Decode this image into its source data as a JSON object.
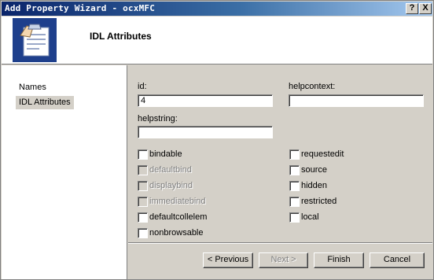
{
  "window": {
    "title": "Add Property Wizard - ocxMFC",
    "help_button": "?",
    "close_button": "X"
  },
  "header": {
    "title": "IDL Attributes",
    "icon": "wizard-clipboard-icon"
  },
  "nav": {
    "items": [
      {
        "label": "Names"
      },
      {
        "label": "IDL Attributes"
      }
    ]
  },
  "form": {
    "id": {
      "label": "id:",
      "value": "4"
    },
    "helpcontext": {
      "label": "helpcontext:",
      "value": ""
    },
    "helpstring": {
      "label": "helpstring:",
      "value": ""
    },
    "left_checkboxes": [
      {
        "label": "bindable",
        "enabled": true,
        "checked": false
      },
      {
        "label": "defaultbind",
        "enabled": false,
        "checked": false
      },
      {
        "label": "displaybind",
        "enabled": false,
        "checked": false
      },
      {
        "label": "immediatebind",
        "enabled": false,
        "checked": false
      },
      {
        "label": "defaultcollelem",
        "enabled": true,
        "checked": false
      },
      {
        "label": "nonbrowsable",
        "enabled": true,
        "checked": false
      }
    ],
    "right_checkboxes": [
      {
        "label": "requestedit",
        "enabled": true,
        "checked": false
      },
      {
        "label": "source",
        "enabled": true,
        "checked": false
      },
      {
        "label": "hidden",
        "enabled": true,
        "checked": false
      },
      {
        "label": "restricted",
        "enabled": true,
        "checked": false
      },
      {
        "label": "local",
        "enabled": true,
        "checked": false
      }
    ]
  },
  "buttons": {
    "previous": "< Previous",
    "next": "Next >",
    "finish": "Finish",
    "cancel": "Cancel"
  }
}
